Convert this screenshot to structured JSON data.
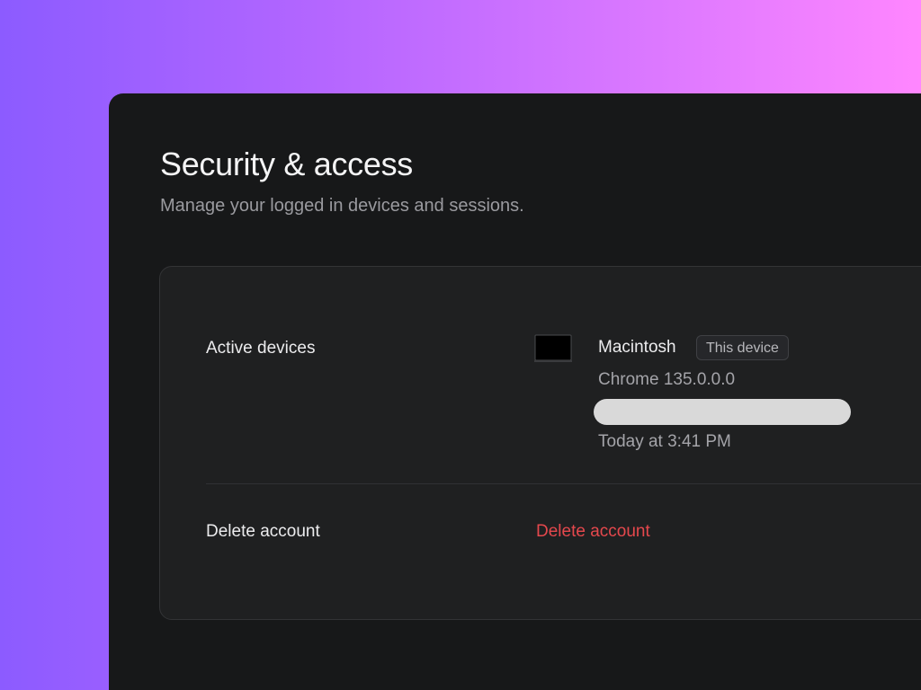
{
  "header": {
    "title": "Security & access",
    "subtitle": "Manage your logged in devices and sessions."
  },
  "sections": {
    "active_devices": {
      "label": "Active devices",
      "device": {
        "icon": "laptop-icon",
        "name": "Macintosh",
        "badge": "This device",
        "browser": "Chrome 135.0.0.0",
        "last_active": "Today at 3:41 PM"
      }
    },
    "delete_account": {
      "label": "Delete account",
      "action_label": "Delete account"
    }
  },
  "colors": {
    "danger": "#e5484d",
    "window_background": "#171819",
    "card_background": "#1f2021"
  }
}
